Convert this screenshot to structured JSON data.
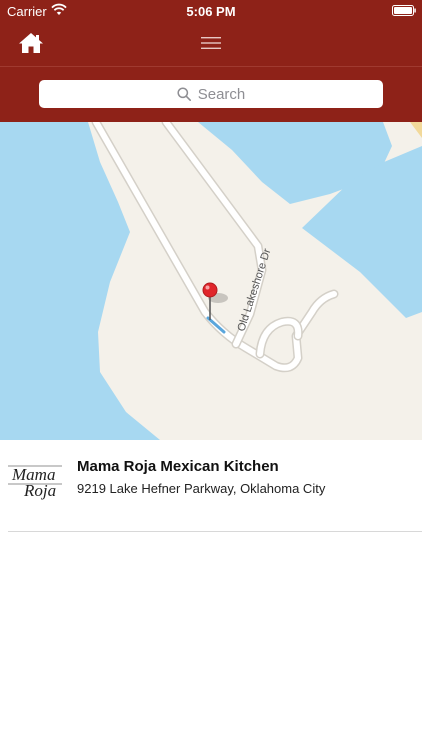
{
  "status_bar": {
    "carrier": "Carrier",
    "time": "5:06 PM"
  },
  "nav": {
    "home_icon": "home-icon",
    "menu_icon": "hamburger-menu-icon"
  },
  "search": {
    "placeholder": "Search",
    "icon": "search-icon"
  },
  "map": {
    "street_label": "Old Lakeshore Dr"
  },
  "listing": {
    "logo_text_line1": "Mama",
    "logo_text_line2": "Roja",
    "name": "Mama Roja Mexican Kitchen",
    "address": "9219 Lake Hefner Parkway, Oklahoma City"
  },
  "colors": {
    "brand_red": "#8e2218",
    "water": "#a7d8f1",
    "land": "#f4f1ea",
    "pin": "#e0262b"
  }
}
